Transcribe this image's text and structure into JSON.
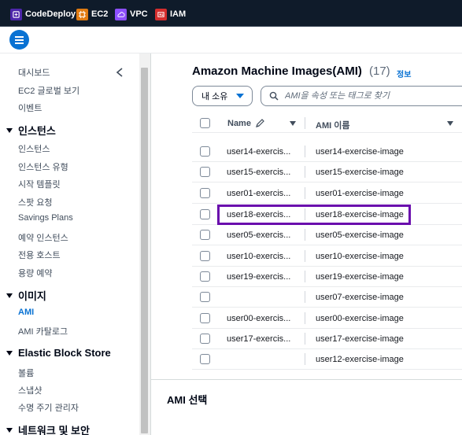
{
  "favorites": [
    {
      "label": "CodeDeploy",
      "icon": "codedeploy-icon",
      "color": "#4d27aa"
    },
    {
      "label": "EC2",
      "icon": "ec2-icon",
      "color": "#e07b12"
    },
    {
      "label": "VPC",
      "icon": "vpc-icon",
      "color": "#8c4fff"
    },
    {
      "label": "IAM",
      "icon": "iam-icon",
      "color": "#d42e2e"
    }
  ],
  "sidebar": {
    "items_top": [
      "대시보드",
      "EC2 글로벌 보기",
      "이벤트"
    ],
    "sections": [
      {
        "title": "인스턴스",
        "items": [
          "인스턴스",
          "인스턴스 유형",
          "시작 템플릿",
          "스팟 요청",
          "Savings Plans",
          "예약 인스턴스",
          "전용 호스트",
          "용량 예약"
        ]
      },
      {
        "title": "이미지",
        "items": [
          "AMI",
          "AMI 카탈로그"
        ]
      },
      {
        "title": "Elastic Block Store",
        "items": [
          "볼륨",
          "스냅샷",
          "수명 주기 관리자"
        ]
      },
      {
        "title": "네트워크 및 보안",
        "items": []
      }
    ],
    "active_item": "AMI"
  },
  "main": {
    "title": "Amazon Machine Images(AMI)",
    "count": "(17)",
    "info_link": "정보",
    "owner_filter": "내 소유",
    "search_placeholder": "AMI을 속성 또는 태그로 찾기"
  },
  "table": {
    "columns": {
      "name": "Name",
      "ami_name": "AMI 이름"
    },
    "rows": [
      {
        "name": "user14-exercis...",
        "ami_name": "user14-exercise-image"
      },
      {
        "name": "user15-exercis...",
        "ami_name": "user15-exercise-image"
      },
      {
        "name": "user01-exercis...",
        "ami_name": "user01-exercise-image"
      },
      {
        "name": "user18-exercis...",
        "ami_name": "user18-exercise-image"
      },
      {
        "name": "user05-exercis...",
        "ami_name": "user05-exercise-image"
      },
      {
        "name": "user10-exercis...",
        "ami_name": "user10-exercise-image"
      },
      {
        "name": "user19-exercis...",
        "ami_name": "user19-exercise-image"
      },
      {
        "name": "",
        "ami_name": "user07-exercise-image"
      },
      {
        "name": "user00-exercis...",
        "ami_name": "user00-exercise-image"
      },
      {
        "name": "user17-exercis...",
        "ami_name": "user17-exercise-image"
      },
      {
        "name": "",
        "ami_name": "user12-exercise-image"
      }
    ]
  },
  "split_panel": {
    "title": "AMI 선택"
  },
  "colors": {
    "accent": "#0972d3",
    "highlight": "#6a0dad",
    "topbar": "#0f1b2a"
  }
}
